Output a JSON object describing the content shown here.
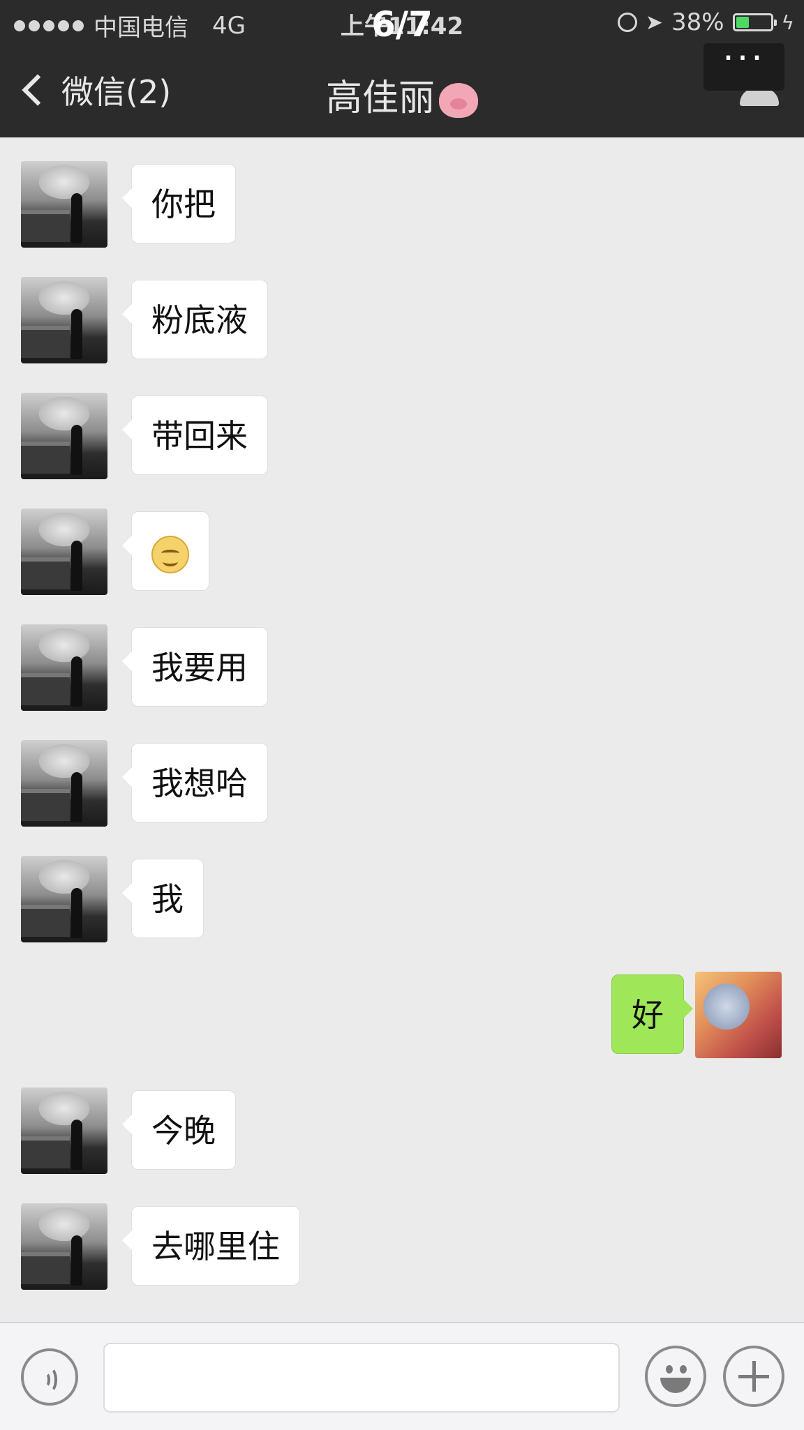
{
  "status_bar": {
    "carrier": "中国电信",
    "network": "4G",
    "time": "上午11:42",
    "battery": "38%",
    "battery_level": 0.38,
    "battery_color": "#4cd964"
  },
  "nav": {
    "back_label": "微信(2)",
    "title": "高佳丽",
    "title_emoji": "pig-face-icon",
    "page_counter": "6/7",
    "more_label": "···"
  },
  "messages": [
    {
      "side": "in",
      "text": "你把"
    },
    {
      "side": "in",
      "text": "粉底液"
    },
    {
      "side": "in",
      "text": "带回来"
    },
    {
      "side": "in",
      "emoji": "smiling-face-icon"
    },
    {
      "side": "in",
      "text": "我要用"
    },
    {
      "side": "in",
      "text": "我想哈"
    },
    {
      "side": "in",
      "text": "我"
    },
    {
      "side": "out",
      "text": "好"
    },
    {
      "side": "in",
      "text": "今晚"
    },
    {
      "side": "in",
      "text": "去哪里住"
    }
  ],
  "colors": {
    "header_bg": "#2b2b2b",
    "chat_bg": "#ebebeb",
    "incoming_bubble": "#ffffff",
    "outgoing_bubble": "#9fe658"
  },
  "input_bar": {
    "voice_icon": "voice-icon",
    "emoji_icon": "emoji-icon",
    "plus_icon": "plus-icon",
    "input_value": ""
  }
}
